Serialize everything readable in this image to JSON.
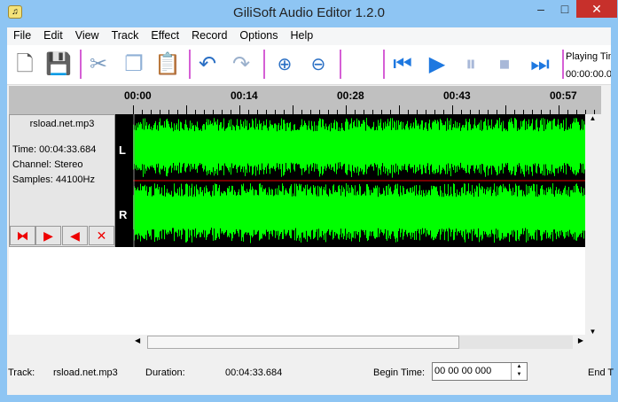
{
  "window": {
    "title": "GiliSoft Audio Editor 1.2.0",
    "minimize": "–",
    "maximize": "□",
    "close": "✕"
  },
  "menu": [
    "File",
    "Edit",
    "View",
    "Track",
    "Effect",
    "Record",
    "Options",
    "Help"
  ],
  "toolbar": {
    "playing_label": "Playing Tim",
    "playing_time": "00:00:00.0"
  },
  "ruler": {
    "ticks": [
      "00:00",
      "00:14",
      "00:28",
      "00:43",
      "00:57"
    ]
  },
  "track": {
    "filename": "rsload.net.mp3",
    "time": "Time: 00:04:33.684",
    "channel": "Channel: Stereo",
    "samples": "Samples: 44100Hz",
    "left_label": "L",
    "right_label": "R"
  },
  "status": {
    "track_label": "Track:",
    "track_value": "rsload.net.mp3",
    "duration_label": "Duration:",
    "duration_value": "00:04:33.684",
    "begin_label": "Begin Time:",
    "begin_value": "00 00 00 000",
    "end_label": "End T"
  },
  "colors": {
    "wave": "#00ff00",
    "separator": "#d55fd5"
  }
}
